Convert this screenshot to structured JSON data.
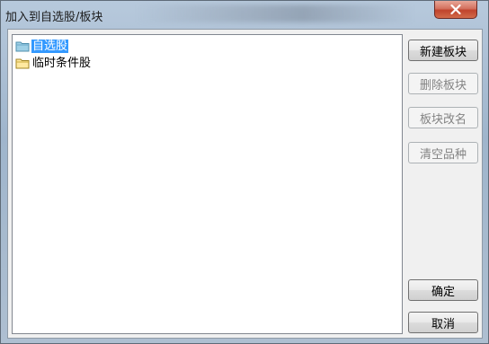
{
  "window": {
    "title": "加入到自选股/板块",
    "close_icon": "close-icon"
  },
  "tree": {
    "items": [
      {
        "label": "自选股",
        "icon": "folder-open-icon",
        "selected": true
      },
      {
        "label": "临时条件股",
        "icon": "folder-icon",
        "selected": false
      }
    ]
  },
  "buttons": {
    "new_block": "新建板块",
    "delete_block": "删除板块",
    "rename_block": "板块改名",
    "clear_items": "清空品种",
    "ok": "确定",
    "cancel": "取消"
  },
  "colors": {
    "selection": "#3399ff",
    "close_button": "#c0432c"
  }
}
